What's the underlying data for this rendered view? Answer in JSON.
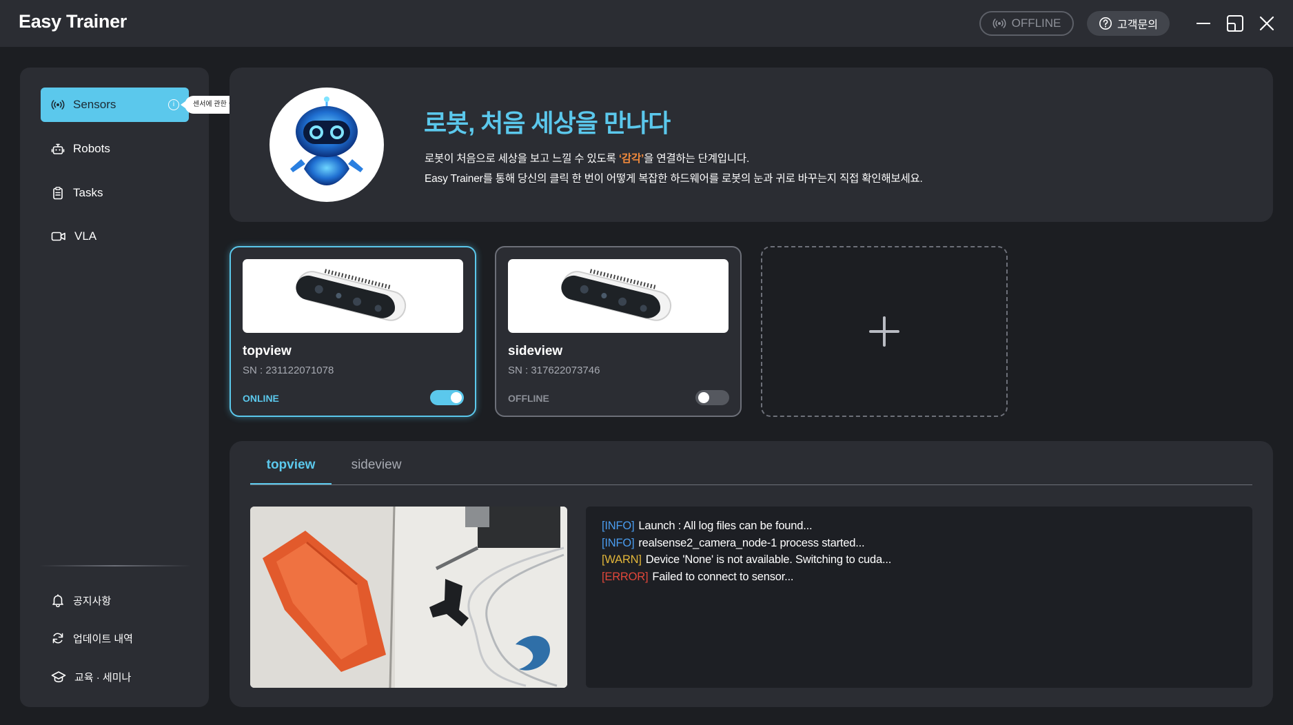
{
  "app": {
    "title": "Easy Trainer"
  },
  "header": {
    "status_label": "OFFLINE",
    "support_label": "고객문의",
    "icons": {
      "status": "broadcast-icon",
      "support": "help-circle-icon",
      "minimize": "minimize-icon",
      "maximize": "maximize-icon",
      "close": "close-icon"
    }
  },
  "sidebar": {
    "items": [
      {
        "label": "Sensors",
        "icon": "broadcast-icon",
        "active": true
      },
      {
        "label": "Robots",
        "icon": "robot-icon"
      },
      {
        "label": "Tasks",
        "icon": "clipboard-icon"
      },
      {
        "label": "VLA",
        "icon": "video-icon"
      }
    ],
    "tooltip": "센서에 관한 설명입니다.",
    "info_icon_glyph": "i",
    "footer": [
      {
        "label": "공지사항",
        "icon": "bell-icon"
      },
      {
        "label": "업데이트 내역",
        "icon": "refresh-icon"
      },
      {
        "label": "교육 · 세미나",
        "icon": "graduation-cap-icon"
      }
    ]
  },
  "banner": {
    "title": "로봇, 처음 세상을 만나다",
    "line1_prefix": "로봇이 처음으로 세상을 보고 느낄 수 있도록 ",
    "line1_highlight": "‘감각’",
    "line1_suffix": "을 연결하는 단계입니다.",
    "line2": "Easy Trainer를 통해 당신의 클릭 한 번이 어떻게 복잡한 하드웨어를 로봇의 눈과 귀로 바꾸는지 직접 확인해보세요."
  },
  "sensors": [
    {
      "name": "topview",
      "sn": "SN : 231122071078",
      "status": "ONLINE",
      "enabled": true,
      "selected": true
    },
    {
      "name": "sideview",
      "sn": "SN : 317622073746",
      "status": "OFFLINE",
      "enabled": false,
      "selected": false
    }
  ],
  "add_sensor": {
    "icon": "plus-icon"
  },
  "panel": {
    "tabs": [
      {
        "label": "topview",
        "active": true
      },
      {
        "label": "sideview",
        "active": false
      }
    ],
    "logs": [
      {
        "level": "[INFO]",
        "message": "Launch : All log files can be found...",
        "color": "#4a9df0"
      },
      {
        "level": "[INFO]",
        "message": "realsense2_camera_node-1 process started...",
        "color": "#4a9df0"
      },
      {
        "level": "[WARN]",
        "message": "Device 'None' is not available. Switching to cuda...",
        "color": "#e2b63a"
      },
      {
        "level": "[ERROR]",
        "message": "Failed to connect to sensor...",
        "color": "#e2473a"
      }
    ]
  },
  "colors": {
    "accent": "#5bc8ec",
    "highlight": "#f0893c",
    "online": "#5bc8ec",
    "offline": "#8d9098"
  }
}
